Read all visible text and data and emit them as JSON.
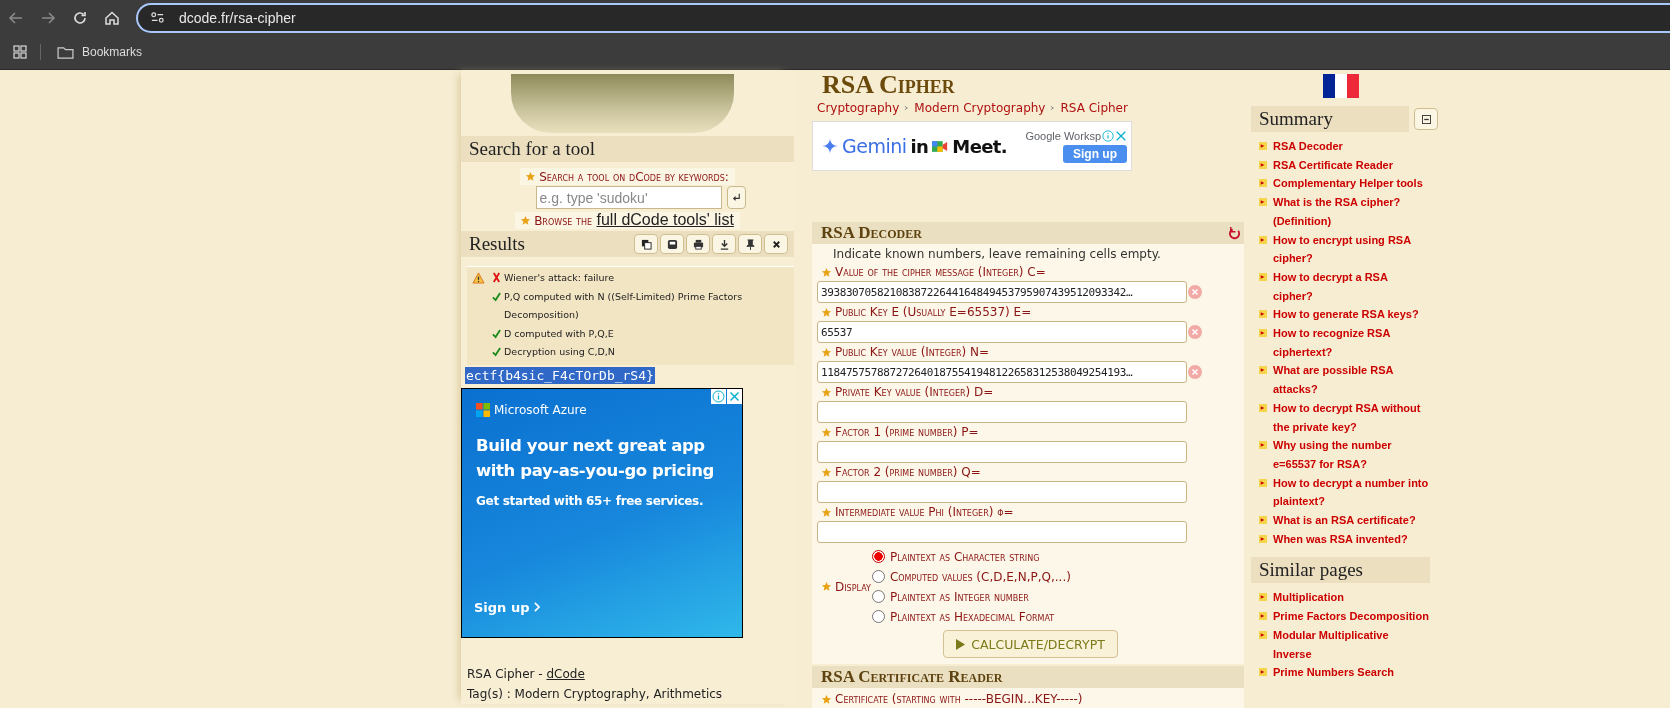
{
  "browser": {
    "url": "dcode.fr/rsa-cipher",
    "bookmarks": "Bookmarks"
  },
  "left": {
    "search_title": "Search for a tool",
    "search_label": "Search a tool on dCode by keywords:",
    "search_placeholder": "e.g. type 'sudoku'",
    "browse_prefix": "Browse the",
    "browse_link": "full dCode tools' list",
    "results_title": "Results",
    "result_lines": [
      {
        "kind": "fail",
        "text": "Wiener's attack: failure"
      },
      {
        "kind": "ok",
        "text": "P,Q computed with N ((Self-Limited) Prime Factors Decomposition)"
      },
      {
        "kind": "ok",
        "text": "D computed with P,Q,E"
      },
      {
        "kind": "ok",
        "text": "Decryption using C,D,N"
      }
    ],
    "result_output": "ectf{b4sic_F4cTOrDb_rS4}",
    "ad": {
      "brand": "Microsoft Azure",
      "headline": "Build your next great app with pay-as-you-go pricing",
      "subline": "Get started with 65+ free services.",
      "cta": "Sign up"
    },
    "footer_title": "RSA Cipher -",
    "footer_link": "dCode",
    "tags": "Tag(s) : Modern Cryptography, Arithmetics"
  },
  "middle": {
    "title": "RSA Cipher",
    "breadcrumbs": [
      "Cryptography",
      "Modern Cryptography",
      "RSA Cipher"
    ],
    "ad": {
      "parts": [
        "Gemini",
        "in",
        "Meet."
      ],
      "brand": "Google Worksp",
      "cta": "Sign up"
    },
    "decoder": {
      "title": "RSA Decoder",
      "hint": "Indicate known numbers, leave remaining cells empty.",
      "fields": [
        {
          "label": "Value of the cipher message (Integer) C=",
          "value": "3938307058210838722644164849453795907439512093342…"
        },
        {
          "label": "Public Key E (Usually E=65537) E=",
          "value": "65537"
        },
        {
          "label": "Public Key value (Integer) N=",
          "value": "1184757578872726401875541948122658312538049254193…"
        },
        {
          "label": "Private Key value (Integer) D="
        },
        {
          "label": "Factor 1 (prime number) P="
        },
        {
          "label": "Factor 2 (prime number) Q="
        },
        {
          "label": "Intermediate value Phi (Integer) φ="
        }
      ],
      "display_label": "Display",
      "options": [
        {
          "label": "Plaintext as Character string",
          "selected": true
        },
        {
          "label": "Computed values (C,D,E,N,P,Q,...)",
          "selected": false
        },
        {
          "label": "Plaintext as Integer number",
          "selected": false
        },
        {
          "label": "Plaintext as Hexadecimal Format",
          "selected": false
        }
      ],
      "button": "CALCULATE/DECRYPT"
    },
    "certificate": {
      "title": "RSA Certificate Reader",
      "label": "Certificate (starting with -----BEGIN...KEY-----)"
    }
  },
  "right": {
    "summary_title": "Summary",
    "summary": [
      "RSA Decoder",
      "RSA Certificate Reader",
      "Complementary Helper tools",
      "What is the RSA cipher? (Definition)",
      "How to encrypt using RSA cipher?",
      "How to decrypt a RSA cipher?",
      "How to generate RSA keys?",
      "How to recognize RSA ciphertext?",
      "What are possible RSA attacks?",
      "How to decrypt RSA without the private key?",
      "Why using the number e=65537 for RSA?",
      "How to decrypt a number into plaintext?",
      "What is an RSA certificate?",
      "When was RSA invented?"
    ],
    "similar_title": "Similar pages",
    "similar": [
      "Multiplication",
      "Prime Factors Decomposition",
      "Modular Multiplicative Inverse",
      "Prime Numbers Search"
    ]
  }
}
